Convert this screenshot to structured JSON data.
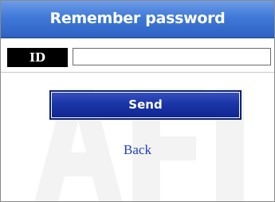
{
  "header": {
    "title": "Remember password"
  },
  "form": {
    "id_label": "ID",
    "id_value": "",
    "send_label": "Send",
    "back_label": "Back"
  },
  "colors": {
    "header_blue": "#3f79d8",
    "button_blue": "#1a35a6",
    "link_blue": "#1f3fbf"
  }
}
